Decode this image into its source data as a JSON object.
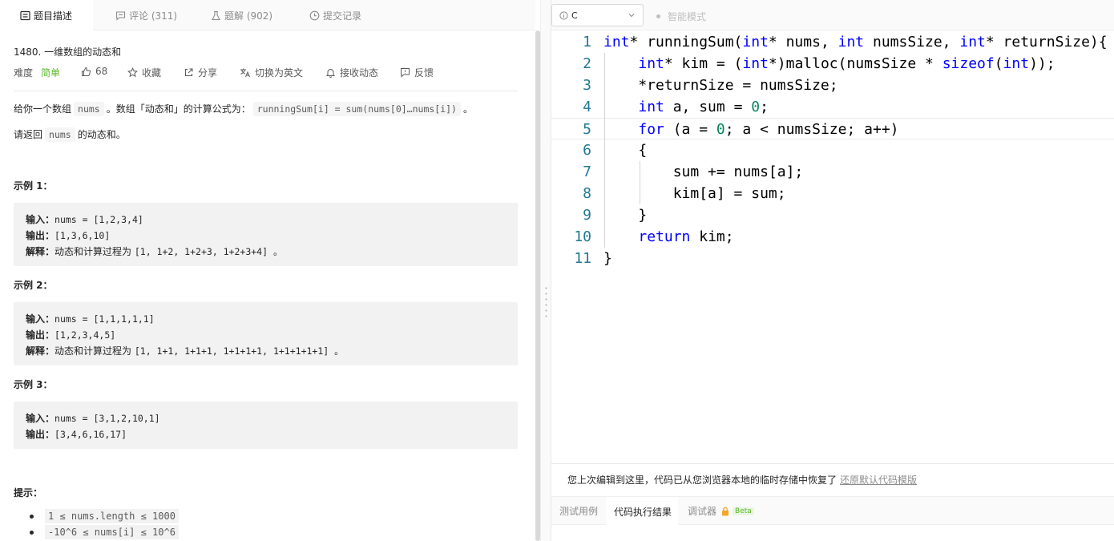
{
  "tabs": {
    "description": "题目描述",
    "comments": "评论 (311)",
    "solutions": "题解 (902)",
    "submissions": "提交记录"
  },
  "problem": {
    "title": "1480. 一维数组的动态和",
    "difficulty_label": "难度",
    "difficulty": "简单",
    "likes": "68",
    "favorite": "收藏",
    "share": "分享",
    "switch_lang": "切换为英文",
    "subscribe": "接收动态",
    "feedback": "反馈",
    "desc_pre": "给你一个数组",
    "desc_code1": "nums",
    "desc_mid": "。数组「动态和」的计算公式为：",
    "desc_code2": "runningSum[i] = sum(nums[0]…nums[i])",
    "desc_post": "。",
    "ret_pre": "请返回",
    "ret_code": "nums",
    "ret_post": "的动态和。",
    "input_label": "输入：",
    "output_label": "输出：",
    "explain_label": "解释：",
    "examples": [
      {
        "heading": "示例 1：",
        "input": "nums = [1,2,3,4]",
        "output": "[1,3,6,10]",
        "explain_text": "动态和计算过程为",
        "explain_code": "[1, 1+2, 1+2+3, 1+2+3+4] 。"
      },
      {
        "heading": "示例 2：",
        "input": "nums = [1,1,1,1,1]",
        "output": "[1,2,3,4,5]",
        "explain_text": "动态和计算过程为",
        "explain_code": "[1, 1+1, 1+1+1, 1+1+1+1, 1+1+1+1+1] 。"
      },
      {
        "heading": "示例 3：",
        "input": "nums = [3,1,2,10,1]",
        "output": "[3,4,6,16,17]"
      }
    ],
    "hints_heading": "提示：",
    "hints": [
      "1 ≤ nums.length ≤ 1000",
      "-10^6 ≤ nums[i] ≤ 10^6"
    ]
  },
  "editor": {
    "language": "C",
    "smart_mode": "智能模式",
    "line_numbers": [
      "1",
      "2",
      "3",
      "4",
      "5",
      "6",
      "7",
      "8",
      "9",
      "10",
      "11"
    ],
    "code": [
      [
        [
          "int",
          "kw"
        ],
        [
          "* runningSum(",
          ""
        ],
        [
          "int",
          "kw"
        ],
        [
          "* nums, ",
          ""
        ],
        [
          "int",
          "kw"
        ],
        [
          " numsSize, ",
          ""
        ],
        [
          "int",
          "kw"
        ],
        [
          "* returnSize){",
          ""
        ]
      ],
      [
        [
          "    ",
          ""
        ],
        [
          "int",
          "kw"
        ],
        [
          "* kim = (",
          ""
        ],
        [
          "int",
          "kw"
        ],
        [
          "*)malloc(numsSize * ",
          ""
        ],
        [
          "sizeof",
          "kw"
        ],
        [
          "(",
          ""
        ],
        [
          "int",
          "kw"
        ],
        [
          "));",
          ""
        ]
      ],
      [
        [
          "    *returnSize = numsSize;",
          ""
        ]
      ],
      [
        [
          "    ",
          ""
        ],
        [
          "int",
          "kw"
        ],
        [
          " a, sum = ",
          ""
        ],
        [
          "0",
          "num"
        ],
        [
          ";",
          ""
        ]
      ],
      [
        [
          "    ",
          ""
        ],
        [
          "for",
          "kw"
        ],
        [
          " (a = ",
          ""
        ],
        [
          "0",
          "num"
        ],
        [
          "; a < numsSize; a++)",
          ""
        ]
      ],
      [
        [
          "    {",
          ""
        ]
      ],
      [
        [
          "        sum += nums[a];",
          ""
        ]
      ],
      [
        [
          "        kim[a] = sum;",
          ""
        ]
      ],
      [
        [
          "    }",
          ""
        ]
      ],
      [
        [
          "    ",
          ""
        ],
        [
          "return",
          "kw"
        ],
        [
          " kim;",
          ""
        ]
      ],
      [
        [
          "}",
          ""
        ]
      ]
    ],
    "notice_text": "您上次编辑到这里，代码已从您浏览器本地的临时存储中恢复了",
    "notice_link": "还原默认代码模版"
  },
  "bottom_tabs": {
    "testcase": "测试用例",
    "result": "代码执行结果",
    "debugger": "调试器",
    "beta": "Beta"
  }
}
